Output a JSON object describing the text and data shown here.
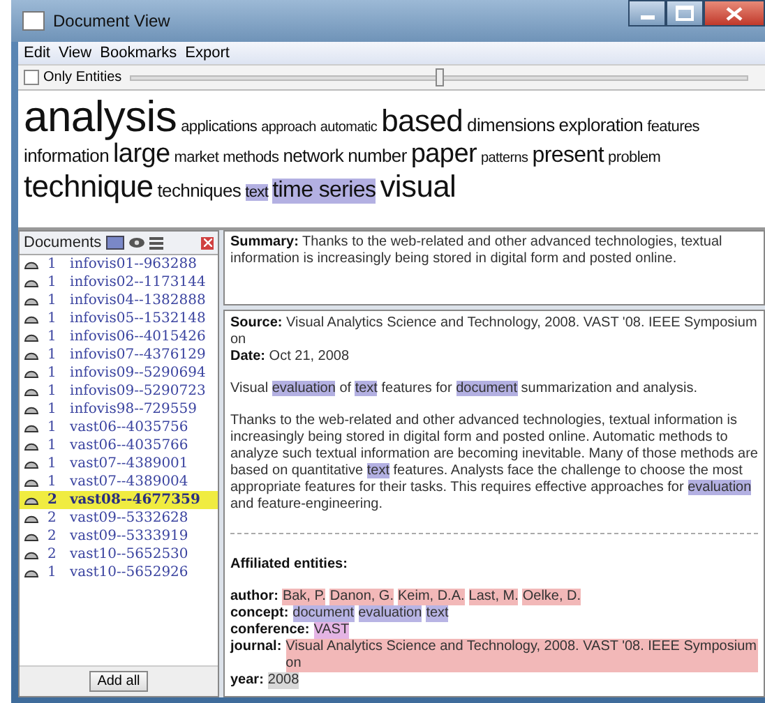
{
  "window": {
    "title": "Document View"
  },
  "menu": [
    "Edit",
    "View",
    "Bookmarks",
    "Export"
  ],
  "toolbar": {
    "checkbox": {
      "label": "Only Entities",
      "checked": false
    },
    "slider": {
      "level": 0.5
    }
  },
  "tag_cloud": [
    {
      "word": "analysis",
      "kind": "huge",
      "highlighted": false
    },
    {
      "word": "applications",
      "kind": "small",
      "highlighted": false
    },
    {
      "word": "approach",
      "kind": "tiny",
      "highlighted": false
    },
    {
      "word": "automatic",
      "kind": "tiny",
      "highlighted": false
    },
    {
      "word": "based",
      "kind": "xlarge",
      "highlighted": false
    },
    {
      "word": "dimensions",
      "kind": "medium",
      "highlighted": false
    },
    {
      "word": "exploration",
      "kind": "medium",
      "highlighted": false
    },
    {
      "word": "features",
      "kind": "small",
      "highlighted": false
    },
    {
      "word": "information",
      "kind": "medium",
      "highlighted": false
    },
    {
      "word": "large",
      "kind": "large",
      "highlighted": false
    },
    {
      "word": "market",
      "kind": "small",
      "highlighted": false
    },
    {
      "word": "methods",
      "kind": "small",
      "highlighted": false
    },
    {
      "word": "network",
      "kind": "medium",
      "highlighted": false
    },
    {
      "word": "number",
      "kind": "medium",
      "highlighted": false
    },
    {
      "word": "paper",
      "kind": "large",
      "highlighted": false
    },
    {
      "word": "patterns",
      "kind": "tiny",
      "highlighted": false
    },
    {
      "word": "present",
      "kind": "big",
      "highlighted": false
    },
    {
      "word": "problem",
      "kind": "small",
      "highlighted": false
    },
    {
      "word": "technique",
      "kind": "xlarge",
      "highlighted": false
    },
    {
      "word": "techniques",
      "kind": "medium",
      "highlighted": false
    },
    {
      "word": "text",
      "kind": "small",
      "highlighted": true
    },
    {
      "word": "time series",
      "kind": "big",
      "highlighted": true
    },
    {
      "word": "visual",
      "kind": "xlarge",
      "highlighted": false
    }
  ],
  "documents": {
    "title": "Documents",
    "items": [
      {
        "count": "1",
        "name": "infovis01--963288",
        "selected": false
      },
      {
        "count": "1",
        "name": "infovis02--1173144",
        "selected": false
      },
      {
        "count": "1",
        "name": "infovis04--1382888",
        "selected": false
      },
      {
        "count": "1",
        "name": "infovis05--1532148",
        "selected": false
      },
      {
        "count": "1",
        "name": "infovis06--4015426",
        "selected": false
      },
      {
        "count": "1",
        "name": "infovis07--4376129",
        "selected": false
      },
      {
        "count": "1",
        "name": "infovis09--5290694",
        "selected": false
      },
      {
        "count": "1",
        "name": "infovis09--5290723",
        "selected": false
      },
      {
        "count": "1",
        "name": "infovis98--729559",
        "selected": false
      },
      {
        "count": "1",
        "name": "vast06--4035756",
        "selected": false
      },
      {
        "count": "1",
        "name": "vast06--4035766",
        "selected": false
      },
      {
        "count": "1",
        "name": "vast07--4389001",
        "selected": false
      },
      {
        "count": "1",
        "name": "vast07--4389004",
        "selected": false
      },
      {
        "count": "2",
        "name": "vast08--4677359",
        "selected": true
      },
      {
        "count": "2",
        "name": "vast09--5332628",
        "selected": false
      },
      {
        "count": "2",
        "name": "vast09--5333919",
        "selected": false
      },
      {
        "count": "2",
        "name": "vast10--5652530",
        "selected": false
      },
      {
        "count": "1",
        "name": "vast10--5652926",
        "selected": false
      }
    ],
    "button": "Add all"
  },
  "summary": {
    "label": "Summary:",
    "text": "Thanks to the web-related and other advanced technologies, textual information is increasingly being stored in digital form and posted online."
  },
  "details": {
    "source": {
      "label": "Source:",
      "text": "Visual Analytics Science and Technology, 2008. VAST '08. IEEE Symposium on"
    },
    "date": {
      "label": "Date:",
      "text": "Oct 21, 2008"
    },
    "paragraphs": [
      [
        {
          "text": "Visual ",
          "kind": "plain"
        },
        {
          "text": "evaluation",
          "kind": "term"
        },
        {
          "text": " of ",
          "kind": "plain"
        },
        {
          "text": "text",
          "kind": "term"
        },
        {
          "text": " features for ",
          "kind": "plain"
        },
        {
          "text": "document",
          "kind": "term"
        },
        {
          "text": " summarization and analysis.",
          "kind": "plain"
        }
      ],
      [
        {
          "text": "Thanks to the web-related and other advanced technologies, textual information is increasingly being stored in digital form and posted online. Automatic methods to analyze such textual information are becoming inevitable. Many of those methods are based on quantitative ",
          "kind": "plain"
        },
        {
          "text": "text",
          "kind": "term"
        },
        {
          "text": " features. Analysts face the challenge to choose the most appropriate features for their tasks. This requires effective approaches for ",
          "kind": "plain"
        },
        {
          "text": "evaluation",
          "kind": "term"
        },
        {
          "text": " and feature-engineering.",
          "kind": "plain"
        }
      ]
    ],
    "entities_title": "Affiliated entities:",
    "entities": [
      {
        "label": "author:",
        "color": "#f2b8b8",
        "values": [
          "Bak, P.",
          "Danon, G.",
          "Keim, D.A.",
          "Last, M.",
          "Oelke, D."
        ]
      },
      {
        "label": "concept:",
        "color": "#b8b4e4",
        "values": [
          "document",
          "evaluation",
          "text"
        ]
      },
      {
        "label": "conference:",
        "color": "#e4b4e4",
        "values": [
          "VAST"
        ]
      },
      {
        "label": "journal:",
        "color": "#f2b8b8",
        "values": [
          "Visual Analytics Science and Technology, 2008. VAST '08. IEEE Symposium on"
        ]
      },
      {
        "label": "year:",
        "color": "#d8d8d8",
        "values": [
          "2008"
        ]
      }
    ]
  }
}
